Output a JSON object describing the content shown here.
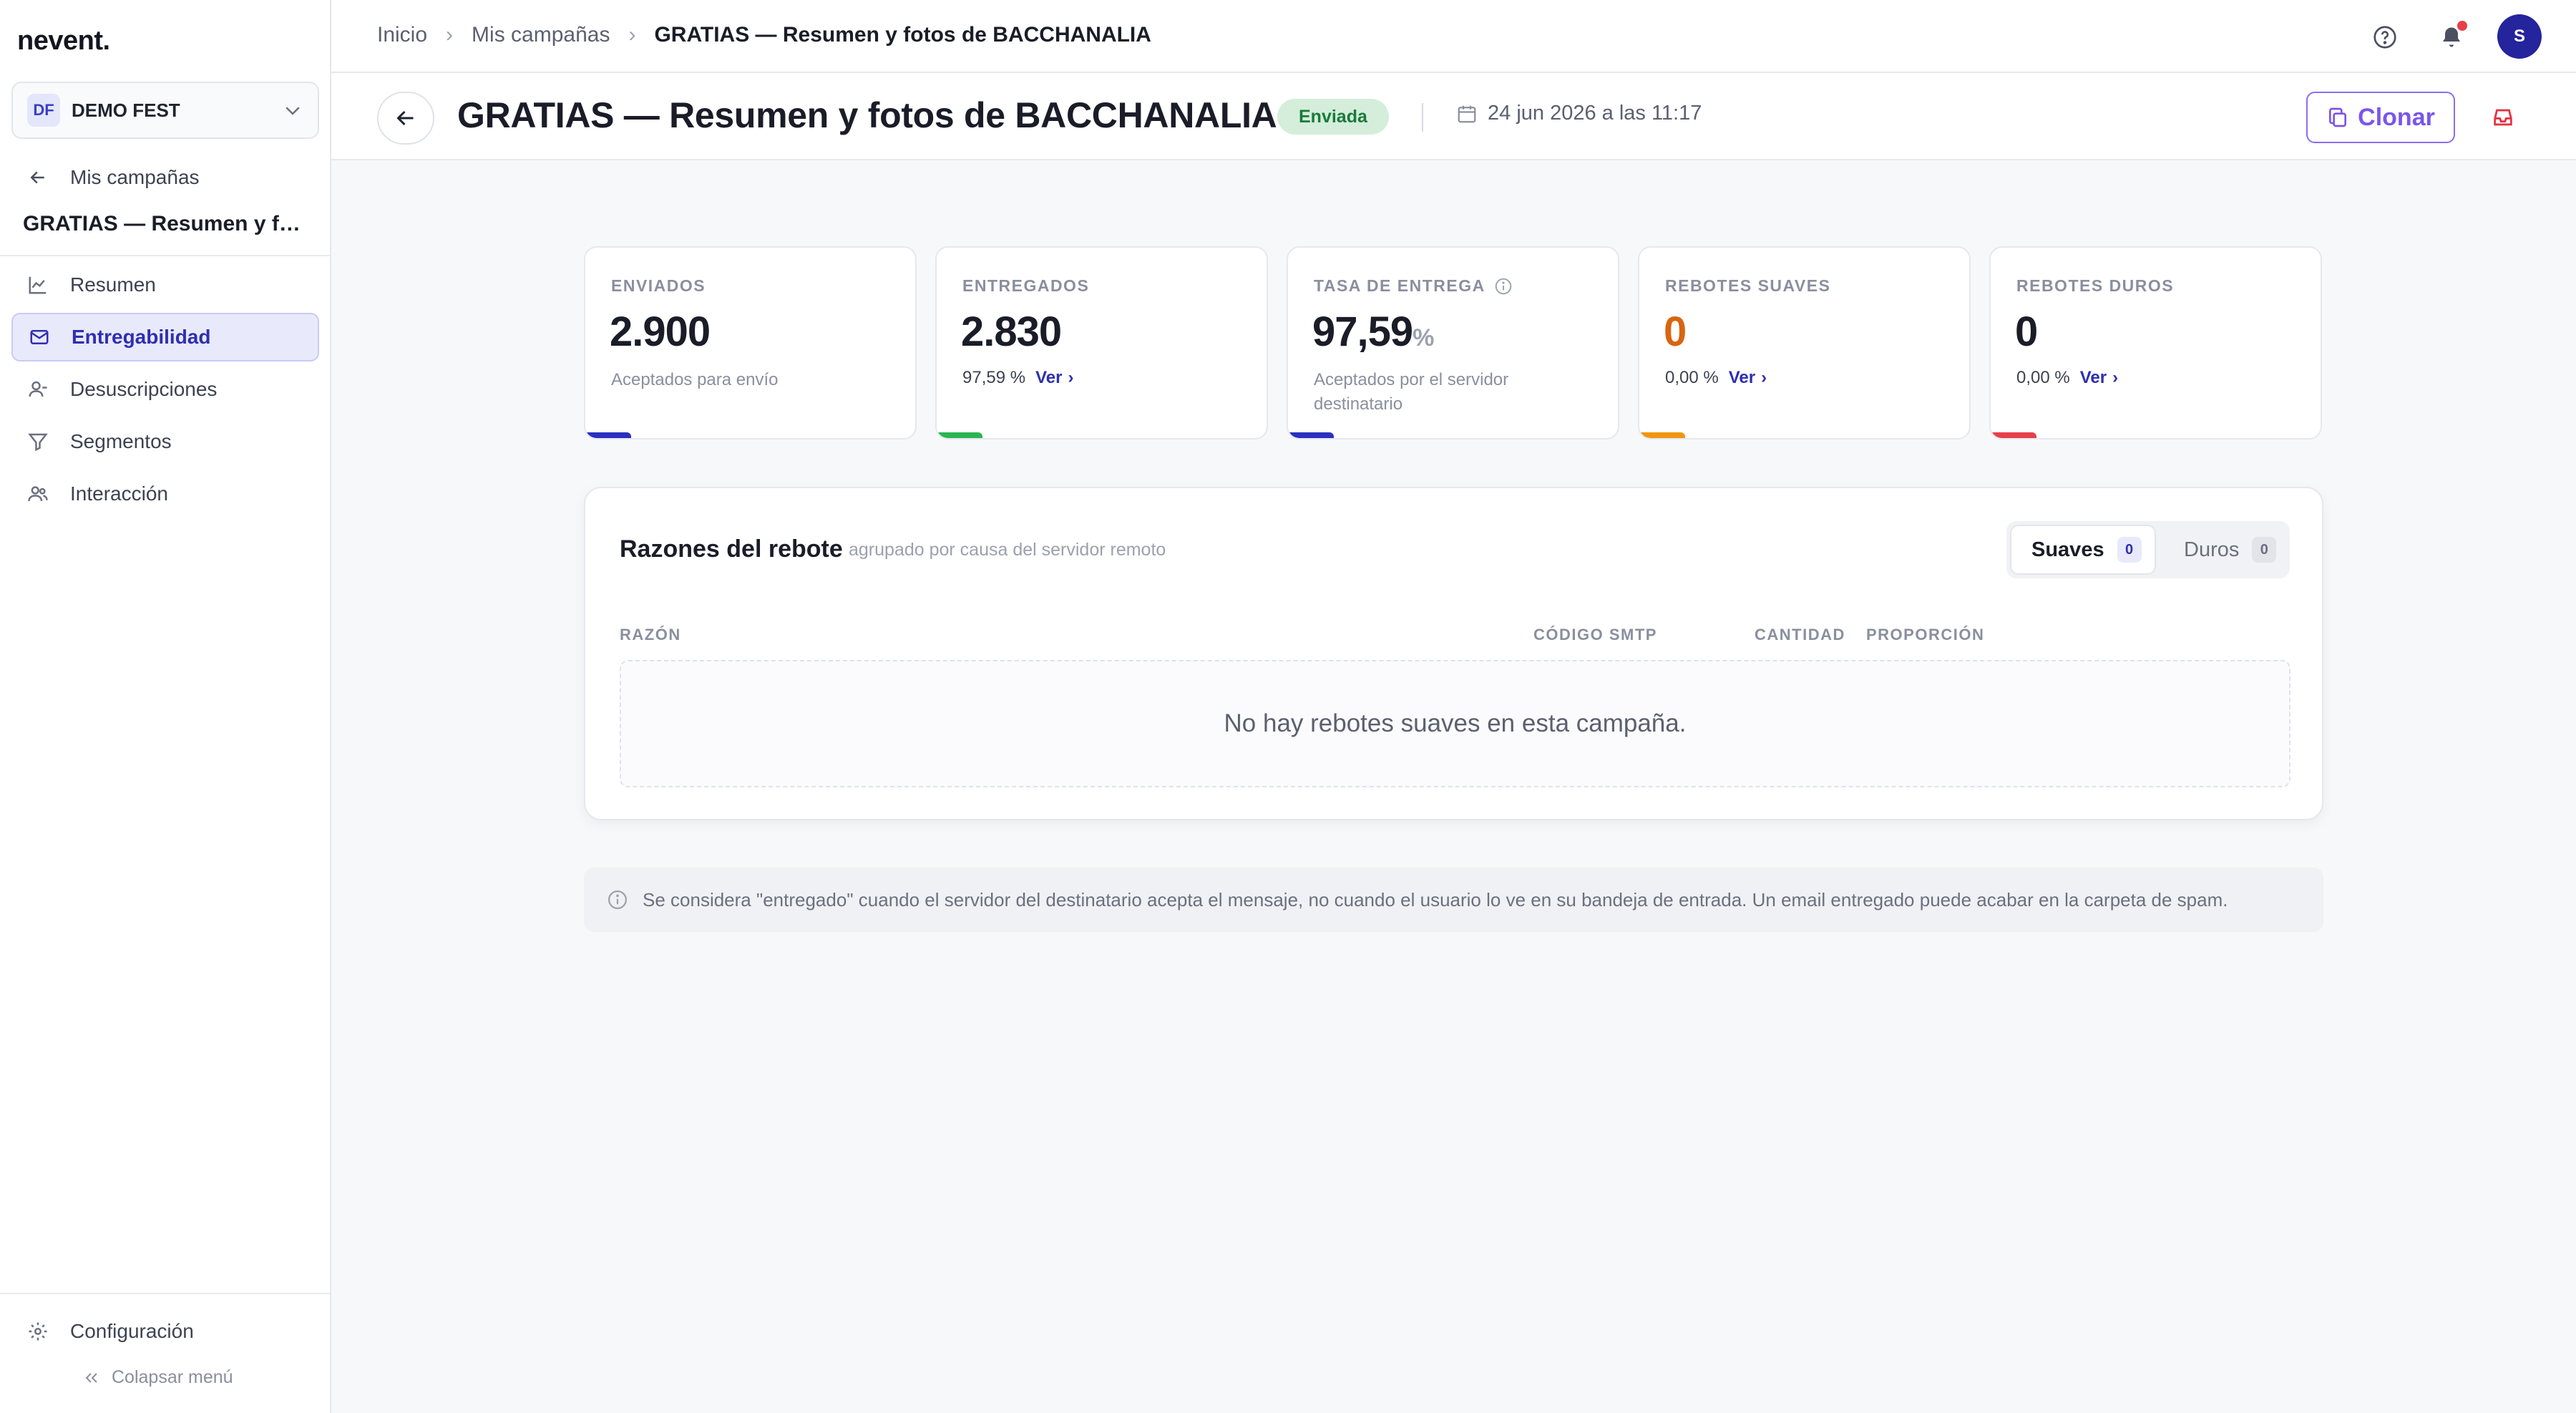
{
  "app": {
    "logo": "nevent."
  },
  "org": {
    "initials": "DF",
    "name": "DEMO FEST"
  },
  "sidebar": {
    "back_label": "Mis campañas",
    "campaign_title": "GRATIAS — Resumen y fotos de BACCHANALIA",
    "items": [
      {
        "label": "Resumen",
        "icon": "chart-line-icon"
      },
      {
        "label": "Entregabilidad",
        "icon": "mail-icon",
        "active": true
      },
      {
        "label": "Desuscripciones",
        "icon": "user-minus-icon"
      },
      {
        "label": "Segmentos",
        "icon": "filter-icon"
      },
      {
        "label": "Interacción",
        "icon": "users-icon"
      }
    ],
    "settings_label": "Configuración",
    "collapse_label": "Colapsar menú"
  },
  "topbar": {
    "breadcrumbs": [
      "Inicio",
      "Mis campañas",
      "GRATIAS — Resumen y fotos de BACCHANALIA"
    ],
    "avatar_initial": "S"
  },
  "header": {
    "title": "GRATIAS — Resumen y fotos de BACCHANALIA",
    "status": "Enviada",
    "date": "24 jun 2026 a las 11:17",
    "clone_label": "Clonar"
  },
  "stats": [
    {
      "label": "ENVIADOS",
      "value": "2.900",
      "sub": "Aceptados para envío",
      "color": "#2a2fc0"
    },
    {
      "label": "ENTREGADOS",
      "value": "2.830",
      "pct": "97,59 %",
      "link": "Ver",
      "color": "#2ab552"
    },
    {
      "label": "TASA DE ENTREGA",
      "value": "97,59",
      "unit": "%",
      "sub": "Aceptados por el servidor destinatario",
      "color": "#2a2fc0"
    },
    {
      "label": "REBOTES SUAVES",
      "value": "0",
      "pct": "0,00 %",
      "link": "Ver",
      "color": "#f0960f",
      "value_color": "#d9650f"
    },
    {
      "label": "REBOTES DUROS",
      "value": "0",
      "pct": "0,00 %",
      "link": "Ver",
      "color": "#e8404a"
    }
  ],
  "bounce": {
    "title": "Razones del rebote",
    "subtitle": "agrupado por causa del servidor remoto",
    "tabs": [
      {
        "label": "Suaves",
        "count": "0"
      },
      {
        "label": "Duros",
        "count": "0"
      }
    ],
    "columns": [
      "RAZÓN",
      "CÓDIGO SMTP",
      "CANTIDAD",
      "PROPORCIÓN"
    ],
    "empty_text": "No hay rebotes suaves en esta campaña."
  },
  "note": "Se considera \"entregado\" cuando el servidor del destinatario acepta el mensaje, no cuando el usuario lo ve en su bandeja de entrada. Un email entregado puede acabar en la carpeta de spam."
}
